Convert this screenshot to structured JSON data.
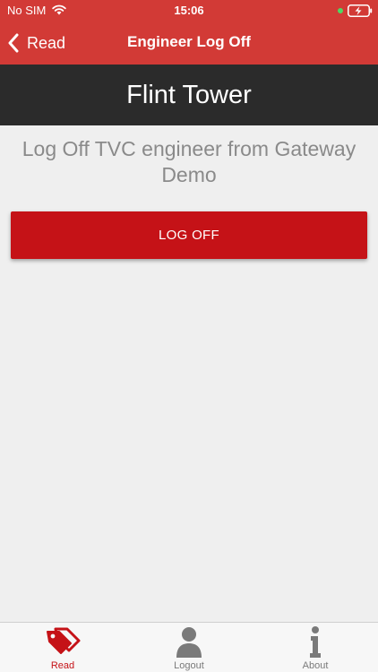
{
  "status_bar": {
    "carrier": "No SIM",
    "time": "15:06"
  },
  "nav": {
    "back_label": "Read",
    "title": "Engineer Log Off"
  },
  "header": {
    "site_name": "Flint Tower"
  },
  "content": {
    "message_line1": "Log Off TVC engineer from Gateway",
    "message_line2": "Demo",
    "button_label": "LOG OFF"
  },
  "tabs": [
    {
      "label": "Read",
      "icon": "tags-icon",
      "active": true
    },
    {
      "label": "Logout",
      "icon": "person-icon",
      "active": false
    },
    {
      "label": "About",
      "icon": "info-icon",
      "active": false
    }
  ],
  "colors": {
    "brand": "#d23a36",
    "header": "#2b2b2b",
    "button": "#c51217",
    "background": "#efefef"
  }
}
